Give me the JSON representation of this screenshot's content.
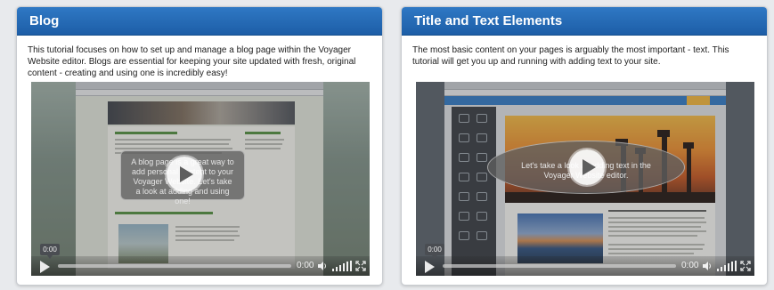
{
  "cards": [
    {
      "title": "Blog",
      "description": "This tutorial focuses on how to set up and manage a blog page within the Voyager Website editor. Blogs are essential for keeping your site updated with fresh, original content - creating and using one is incredibly easy!",
      "video": {
        "overlay_text": "A blog page is a great way to add personal content to your Voyager Website. Let's take a look at adding and using one!",
        "current_time": "0:00",
        "end_time": "0:00",
        "progress": 0,
        "volume_level": 1
      }
    },
    {
      "title": "Title and Text Elements",
      "description": "The most basic content on your pages is arguably the most important - text. This tutorial will get you up and running with adding text to your site.",
      "video": {
        "overlay_text": "Let's take a look at adding text in the Voyager Website editor.",
        "current_time": "0:00",
        "end_time": "0:00",
        "progress": 0,
        "volume_level": 1
      }
    }
  ],
  "icons": {
    "play": "play-icon",
    "volume": "volume-icon",
    "fullscreen": "fullscreen-icon"
  },
  "colors": {
    "header_blue": "#2f78c4",
    "page_bg": "#e8eaed"
  }
}
